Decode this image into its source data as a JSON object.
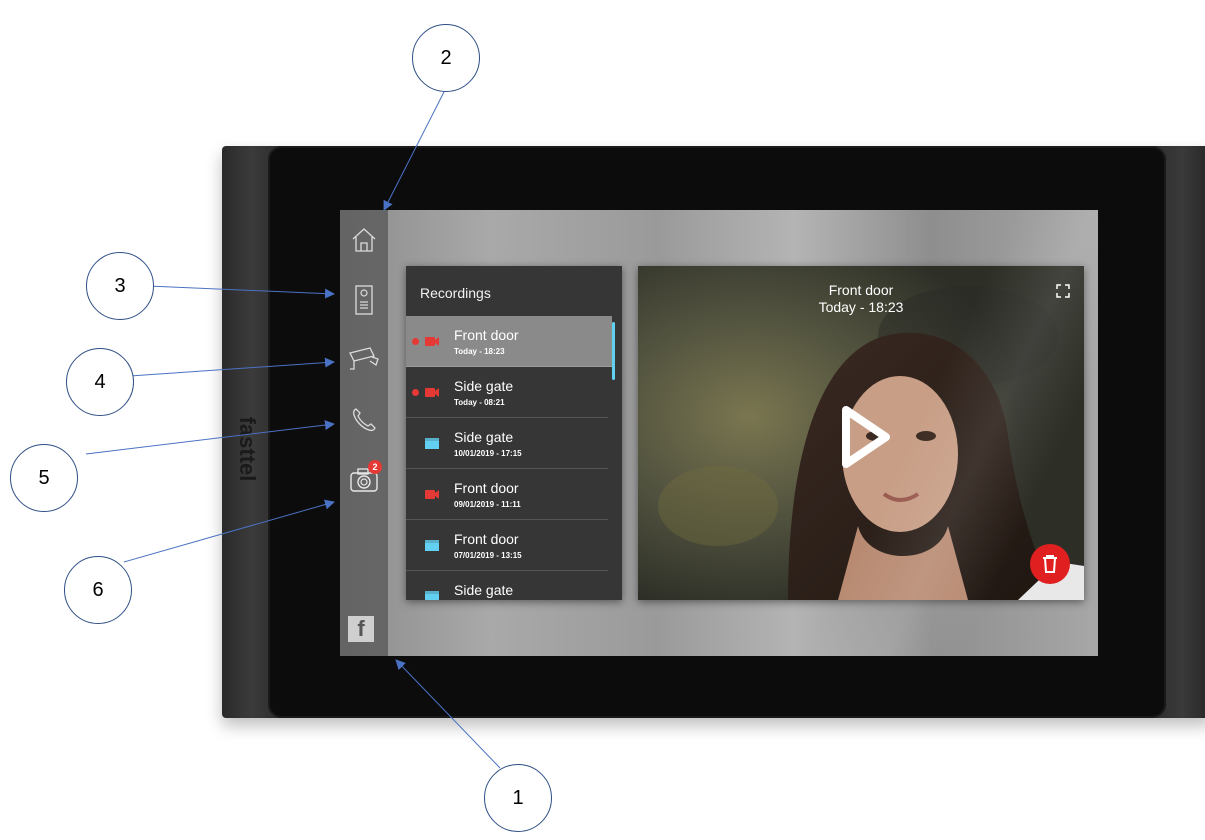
{
  "brand": {
    "vertical_text": "fasttel"
  },
  "sidebar": {
    "items": [
      {
        "name": "home",
        "icon": "home-icon"
      },
      {
        "name": "intercom",
        "icon": "door-panel-icon"
      },
      {
        "name": "cctv",
        "icon": "cctv-camera-icon"
      },
      {
        "name": "calls",
        "icon": "phone-icon"
      },
      {
        "name": "recordings",
        "icon": "camera-icon",
        "badge": "2"
      }
    ],
    "logo_text": "f"
  },
  "recordings_panel": {
    "title": "Recordings",
    "items": [
      {
        "name": "Front door",
        "time": "Today - 18:23",
        "unread": true,
        "type": "video",
        "icon_color": "#e53935",
        "selected": true
      },
      {
        "name": "Side gate",
        "time": "Today - 08:21",
        "unread": true,
        "type": "video",
        "icon_color": "#e53935",
        "selected": false
      },
      {
        "name": "Side gate",
        "time": "10/01/2019 - 17:15",
        "unread": false,
        "type": "clip",
        "icon_color": "#62d0f0",
        "selected": false
      },
      {
        "name": "Front door",
        "time": "09/01/2019 - 11:11",
        "unread": false,
        "type": "video",
        "icon_color": "#e53935",
        "selected": false
      },
      {
        "name": "Front door",
        "time": "07/01/2019 - 13:15",
        "unread": false,
        "type": "clip",
        "icon_color": "#62d0f0",
        "selected": false
      },
      {
        "name": "Side gate",
        "time": "",
        "unread": false,
        "type": "clip",
        "icon_color": "#62d0f0",
        "selected": false
      }
    ]
  },
  "video_panel": {
    "title": "Front door",
    "subtitle": "Today - 18:23"
  },
  "callouts": [
    "1",
    "2",
    "3",
    "4",
    "5",
    "6"
  ],
  "colors": {
    "accent": "#62d0f0",
    "alert": "#e53935",
    "delete": "#e02020"
  }
}
